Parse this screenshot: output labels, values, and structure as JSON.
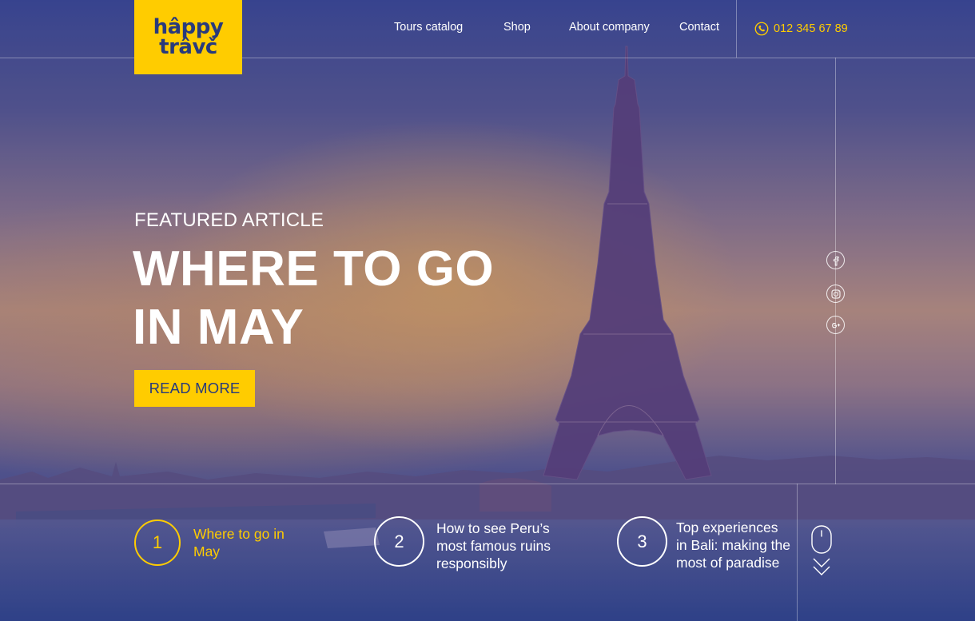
{
  "brand": {
    "logo_line1": "hâppy",
    "logo_line2": "trâvč"
  },
  "nav": {
    "items": [
      {
        "label": "Tours catalog"
      },
      {
        "label": "Shop"
      },
      {
        "label": "About company"
      },
      {
        "label": "Contact"
      }
    ],
    "phone": "012 345 67 89"
  },
  "hero": {
    "eyebrow": "FEATURED ARTICLE",
    "headline_line1": "WHERE TO GO",
    "headline_line2": "IN MAY",
    "cta": "READ MORE"
  },
  "social": {
    "icons": [
      "facebook-icon",
      "instagram-icon",
      "google-plus-icon"
    ]
  },
  "articles": [
    {
      "number": "1",
      "title": "Where to go in May",
      "active": true
    },
    {
      "number": "2",
      "title": "How to see Peru’s most famous ruins responsibly",
      "active": false
    },
    {
      "number": "3",
      "title": "Top experiences in Bali: making the most of paradise",
      "active": false
    }
  ],
  "colors": {
    "accent": "#ffcc00",
    "brand_blue": "#283a7c"
  }
}
